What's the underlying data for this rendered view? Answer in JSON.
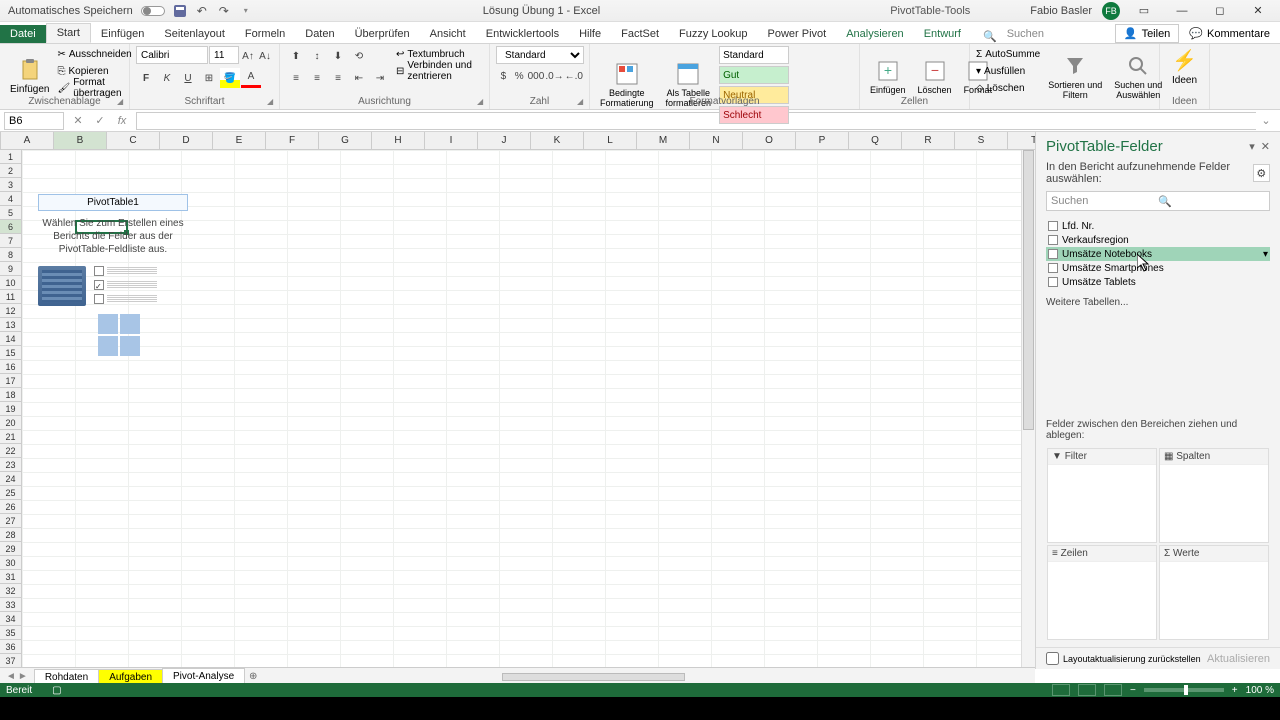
{
  "titlebar": {
    "autosave_label": "Automatisches Speichern",
    "doc_title": "Lösung Übung 1 - Excel",
    "context_tool": "PivotTable-Tools",
    "user_name": "Fabio Basler",
    "user_initials": "FB"
  },
  "tabs": {
    "file": "Datei",
    "items": [
      "Start",
      "Einfügen",
      "Seitenlayout",
      "Formeln",
      "Daten",
      "Überprüfen",
      "Ansicht",
      "Entwicklertools",
      "Hilfe",
      "FactSet",
      "Fuzzy Lookup",
      "Power Pivot",
      "Analysieren",
      "Entwurf"
    ],
    "search": "Suchen",
    "share": "Teilen",
    "comments": "Kommentare"
  },
  "ribbon": {
    "clipboard": {
      "paste": "Einfügen",
      "cut": "Ausschneiden",
      "copy": "Kopieren",
      "format_painter": "Format übertragen",
      "label": "Zwischenablage"
    },
    "font": {
      "name": "Calibri",
      "size": "11",
      "label": "Schriftart"
    },
    "align": {
      "wrap": "Textumbruch",
      "merge": "Verbinden und zentrieren",
      "label": "Ausrichtung"
    },
    "number": {
      "format": "Standard",
      "label": "Zahl"
    },
    "styles": {
      "cond": "Bedingte\nFormatierung",
      "as_table": "Als Tabelle\nformatieren",
      "standard": "Standard",
      "gut": "Gut",
      "neutral": "Neutral",
      "schlecht": "Schlecht",
      "label": "Formatvorlagen"
    },
    "cells": {
      "insert": "Einfügen",
      "delete": "Löschen",
      "format": "Format",
      "label": "Zellen"
    },
    "editing": {
      "autosum": "AutoSumme",
      "fill": "Ausfüllen",
      "clear": "Löschen",
      "sort": "Sortieren und\nFiltern",
      "find": "Suchen und\nAuswählen",
      "label": ""
    },
    "ideas": {
      "btn": "Ideen",
      "label": "Ideen"
    }
  },
  "namebox": "B6",
  "columns": [
    "A",
    "B",
    "C",
    "D",
    "E",
    "F",
    "G",
    "H",
    "I",
    "J",
    "K",
    "L",
    "M",
    "N",
    "O",
    "P",
    "Q",
    "R",
    "S",
    "T"
  ],
  "pivot_placeholder": {
    "title": "PivotTable1",
    "text": "Wählen Sie zum Erstellen eines Berichts die Felder aus der PivotTable-Feldliste aus."
  },
  "fieldpane": {
    "title": "PivotTable-Felder",
    "subtitle": "In den Bericht aufzunehmende Felder auswählen:",
    "search_ph": "Suchen",
    "fields": [
      "Lfd. Nr.",
      "Verkaufsregion",
      "Umsätze Notebooks",
      "Umsätze Smartphones",
      "Umsätze Tablets"
    ],
    "more": "Weitere Tabellen...",
    "areas_label": "Felder zwischen den Bereichen ziehen und ablegen:",
    "area_filter": "Filter",
    "area_cols": "Spalten",
    "area_rows": "Zeilen",
    "area_vals": "Werte",
    "defer": "Layoutaktualisierung zurückstellen",
    "update": "Aktualisieren"
  },
  "sheets": {
    "tabs": [
      "Rohdaten",
      "Aufgaben",
      "Pivot-Analyse"
    ]
  },
  "status": {
    "ready": "Bereit",
    "zoom": "100 %"
  }
}
